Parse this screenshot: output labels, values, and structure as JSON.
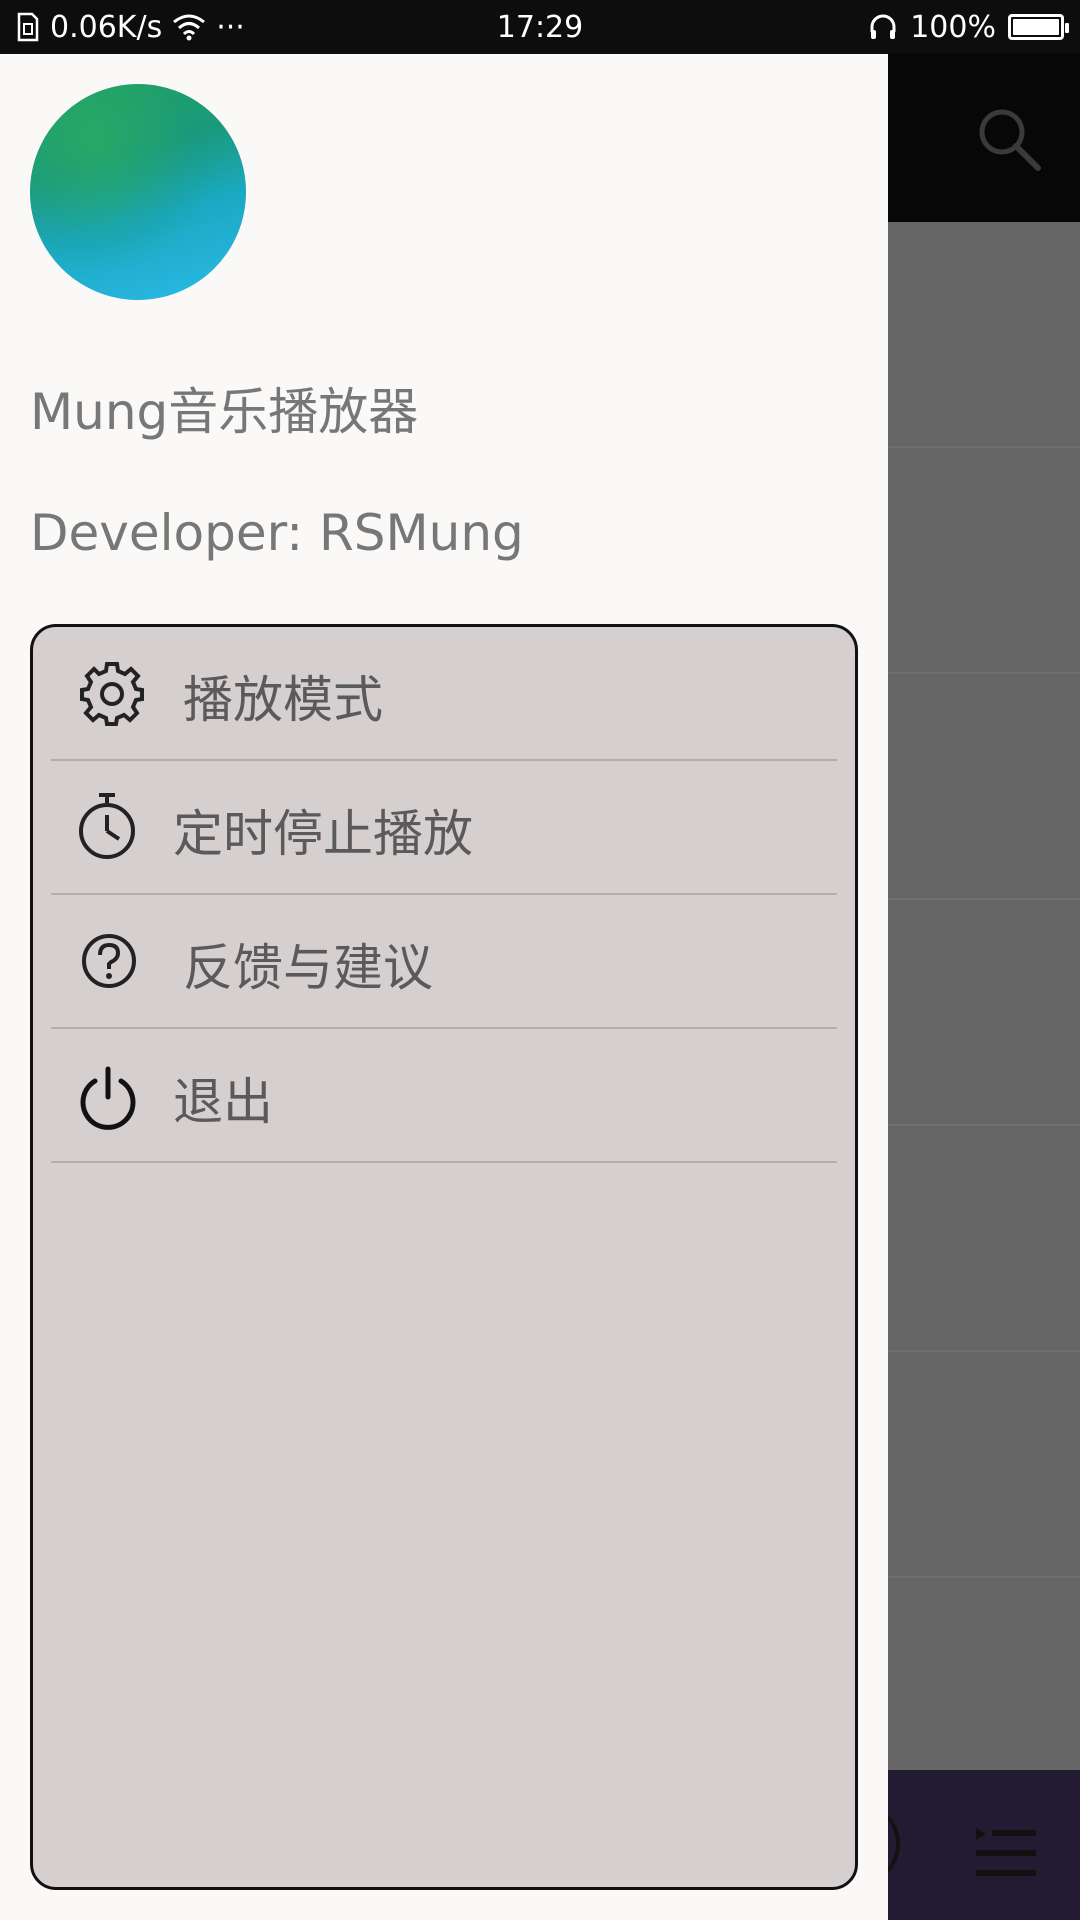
{
  "status_bar": {
    "network_speed": "0.06K/s",
    "more_dots": "···",
    "time": "17:29",
    "battery_text": "100%",
    "battery_level": 1.0
  },
  "drawer": {
    "app_name": "Mung音乐播放器",
    "developer": "Developer: RSMung",
    "menu": [
      {
        "label": "播放模式",
        "icon": "gear-icon"
      },
      {
        "label": "定时停止播放",
        "icon": "timer-icon"
      },
      {
        "label": "反馈与建议",
        "icon": "help-icon"
      },
      {
        "label": "退出",
        "icon": "power-icon"
      }
    ]
  },
  "background_app": {
    "icons": [
      "search-icon",
      "play-icon",
      "playlist-icon"
    ]
  },
  "colors": {
    "drawer_bg": "#faf9f8",
    "menu_panel_bg": "#d6cfcf",
    "scrim": "#636363",
    "toolbar": "#070707",
    "player_bar": "#221b31"
  }
}
